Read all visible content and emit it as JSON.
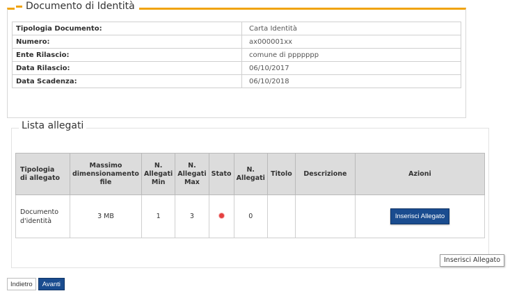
{
  "documento": {
    "legend": "Documento di Identità",
    "rows": [
      {
        "label": "Tipologia Documento:",
        "value": "Carta Identità"
      },
      {
        "label": "Numero:",
        "value": "ax000001xx"
      },
      {
        "label": "Ente Rilascio:",
        "value": "comune di ppppppp"
      },
      {
        "label": "Data Rilascio:",
        "value": "06/10/2017"
      },
      {
        "label": "Data Scadenza:",
        "value": "06/10/2018"
      }
    ]
  },
  "allegati": {
    "legend": "Lista allegati",
    "headers": {
      "tipologia_1": "Tipologia",
      "tipologia_2": "di allegato",
      "massimo_1": "Massimo",
      "massimo_2": "dimensionamento",
      "massimo_3": "file",
      "min_1": "N.",
      "min_2": "Allegati",
      "min_3": "Min",
      "max_1": "N.",
      "max_2": "Allegati",
      "max_3": "Max",
      "stato": "Stato",
      "nall_1": "N.",
      "nall_2": "Allegati",
      "titolo": "Titolo",
      "descrizione": "Descrizione",
      "azioni": "Azioni"
    },
    "row": {
      "tipologia_1": "Documento",
      "tipologia_2": "d'identità",
      "massimo": "3 MB",
      "min": "1",
      "max": "3",
      "stato_color": "#e54040",
      "n_allegati": "0",
      "titolo": "",
      "descrizione": "",
      "azione_label": "Inserisci Allegato"
    }
  },
  "tooltip": "Inserisci Allegato",
  "nav": {
    "back_label": "Indietro",
    "next_label": "Avanti"
  }
}
